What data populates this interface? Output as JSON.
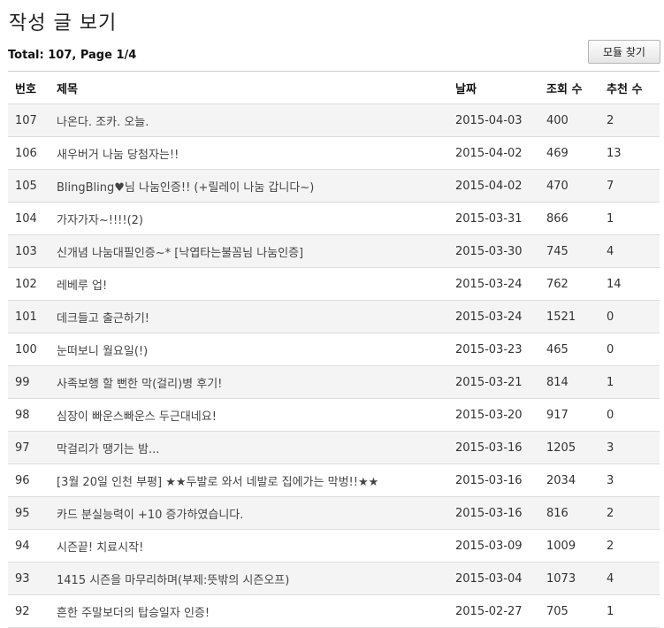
{
  "page": {
    "title": "작성 글 보기",
    "summary": "Total: 107, Page 1/4",
    "find_module_label": "모듈 찾기"
  },
  "table": {
    "headers": {
      "no": "번호",
      "title": "제목",
      "date": "날짜",
      "views": "조회 수",
      "recommend": "추천 수"
    },
    "rows": [
      {
        "no": "107",
        "title": "나온다. 조카. 오늘.",
        "date": "2015-04-03",
        "views": "400",
        "recommend": "2"
      },
      {
        "no": "106",
        "title": "새우버거 나눔 당첨자는!!",
        "date": "2015-04-02",
        "views": "469",
        "recommend": "13"
      },
      {
        "no": "105",
        "title": "BlingBling♥님 나눔인증!! (+릴레이 나눔 갑니다~)",
        "date": "2015-04-02",
        "views": "470",
        "recommend": "7"
      },
      {
        "no": "104",
        "title": "가자가자~!!!!(2)",
        "date": "2015-03-31",
        "views": "866",
        "recommend": "1"
      },
      {
        "no": "103",
        "title": "신개념 나눔대필인증~* [낙엽타는불꼼님 나눔인증]",
        "date": "2015-03-30",
        "views": "745",
        "recommend": "4"
      },
      {
        "no": "102",
        "title": "레베루 업!",
        "date": "2015-03-24",
        "views": "762",
        "recommend": "14"
      },
      {
        "no": "101",
        "title": "데크들고 출근하기!",
        "date": "2015-03-24",
        "views": "1521",
        "recommend": "0"
      },
      {
        "no": "100",
        "title": "눈떠보니 월요일(!)",
        "date": "2015-03-23",
        "views": "465",
        "recommend": "0"
      },
      {
        "no": "99",
        "title": "사족보행 할 뻔한 막(걸리)병 후기!",
        "date": "2015-03-21",
        "views": "814",
        "recommend": "1"
      },
      {
        "no": "98",
        "title": "심장이 빠운스빠운스 두근대네요!",
        "date": "2015-03-20",
        "views": "917",
        "recommend": "0"
      },
      {
        "no": "97",
        "title": "막걸리가 땡기는 밤...",
        "date": "2015-03-16",
        "views": "1205",
        "recommend": "3"
      },
      {
        "no": "96",
        "title": "[3월 20일 인천 부평] ★★두발로 와서 네발로 집에가는 막벙!!★★",
        "date": "2015-03-16",
        "views": "2034",
        "recommend": "3"
      },
      {
        "no": "95",
        "title": "카드 분실능력이 +10 증가하였습니다.",
        "date": "2015-03-16",
        "views": "816",
        "recommend": "2"
      },
      {
        "no": "94",
        "title": "시즌끝! 치료시작!",
        "date": "2015-03-09",
        "views": "1009",
        "recommend": "2"
      },
      {
        "no": "93",
        "title": "1415 시즌을 마무리하며(부제:뜻밖의 시즌오프)",
        "date": "2015-03-04",
        "views": "1073",
        "recommend": "4"
      },
      {
        "no": "92",
        "title": "흔한 주말보더의 탑승일자 인증!",
        "date": "2015-02-27",
        "views": "705",
        "recommend": "1"
      }
    ]
  }
}
